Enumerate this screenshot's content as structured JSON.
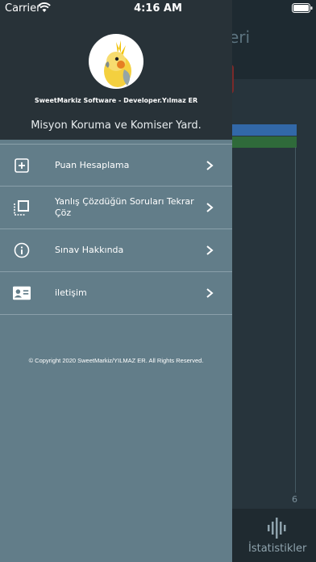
{
  "status_bar": {
    "carrier": "Carrier",
    "time": "4:16 AM"
  },
  "background": {
    "title_partial": "eri",
    "axis_label": "6",
    "tab_label": "İstatistikler"
  },
  "drawer": {
    "developer_text": "SweetMarkiz Software - Developer.Yılmaz ER",
    "title": "Misyon Koruma ve Komiser Yard.",
    "menu": [
      {
        "label": "Puan Hesaplama",
        "icon": "plus-square-icon"
      },
      {
        "label": "Yanlış Çözdüğün Soruları Tekrar Çöz",
        "icon": "crop-frame-icon"
      },
      {
        "label": "Sınav Hakkında",
        "icon": "info-icon"
      },
      {
        "label": "iletişim",
        "icon": "contact-card-icon"
      }
    ],
    "copyright": "© Copyright 2020 SweetMarkiz/YILMAZ ER. All Rights Reserved."
  },
  "colors": {
    "drawer_bg": "#627d89",
    "drawer_header_bg": "#283238",
    "app_bg": "#27343c"
  }
}
